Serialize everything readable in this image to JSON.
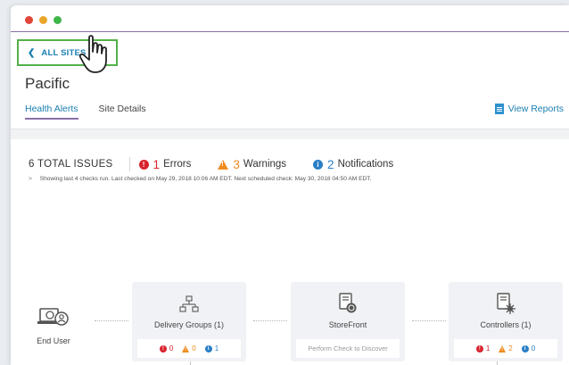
{
  "nav": {
    "back_label": "ALL SITES"
  },
  "site": {
    "title": "Pacific"
  },
  "tabs": [
    {
      "label": "Health Alerts",
      "active": true
    },
    {
      "label": "Site Details",
      "active": false
    }
  ],
  "view_reports": "View Reports",
  "summary": {
    "total": "6 TOTAL ISSUES",
    "errors": {
      "count": "1",
      "label": "Errors"
    },
    "warnings": {
      "count": "3",
      "label": "Warnings"
    },
    "notifications": {
      "count": "2",
      "label": "Notifications"
    },
    "checked_text": "Showing last 4 checks run. Last checked on May 29, 2018 10:06 AM EDT. Next scheduled check: May 30, 2018 04:50 AM EDT."
  },
  "diagram": {
    "end_user": "End User",
    "cards": [
      {
        "title": "Delivery Groups (1)",
        "errors": "0",
        "warnings": "0",
        "info": "1"
      },
      {
        "title": "StoreFront",
        "status_text": "Perform Check to Discover"
      },
      {
        "title": "Controllers (1)",
        "errors": "1",
        "warnings": "2",
        "info": "0"
      }
    ]
  },
  "colors": {
    "accent": "#1a7fb0",
    "error": "#d9232d",
    "warning": "#ef8b1e",
    "info": "#2a7fc6",
    "highlight": "#52b048"
  }
}
